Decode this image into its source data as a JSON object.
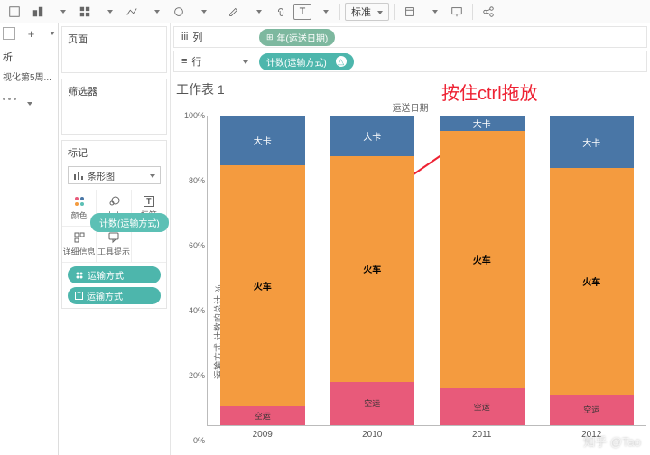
{
  "toolbar": {
    "standard_label": "标准"
  },
  "sidebar_left": {
    "title": "析",
    "subtitle": "视化第5周..."
  },
  "panels": {
    "page": "页面",
    "filter": "筛选器",
    "marks": "标记",
    "mark_type": "条形图",
    "cells": {
      "color": "颜色",
      "size": "大小",
      "label": "标签",
      "detail": "详细信息",
      "tooltip": "工具提示"
    },
    "pill_drag": "计数(运输方式)",
    "pill_field1": "运输方式",
    "pill_field2": "运输方式"
  },
  "shelves": {
    "columns_title": "列",
    "rows_title": "行",
    "columns_pill": "年(运送日期)",
    "rows_pill": "计数(运输方式)"
  },
  "chart": {
    "sheet_title": "工作表 1",
    "annotation": "按住ctrl拖放",
    "sub_header": "运送日期",
    "y_axis_label": "运输方式 计数的总计 %"
  },
  "chart_data": {
    "type": "bar",
    "categories": [
      "2009",
      "2010",
      "2011",
      "2012"
    ],
    "series": [
      {
        "name": "空运",
        "color": "#e85a7a",
        "values": [
          6,
          14,
          12,
          10
        ]
      },
      {
        "name": "火车",
        "color": "#f49b3f",
        "values": [
          78,
          73,
          83,
          73
        ]
      },
      {
        "name": "大卡",
        "color": "#4976a6",
        "values": [
          16,
          13,
          5,
          17
        ]
      }
    ],
    "ylabel": "运输方式 计数的总计 %",
    "ylim": [
      0,
      100
    ],
    "yticks": [
      0,
      20,
      40,
      60,
      80,
      100
    ],
    "ytick_labels": [
      "0%",
      "20%",
      "40%",
      "60%",
      "80%",
      "100%"
    ]
  },
  "watermark": "知乎 @Tao"
}
